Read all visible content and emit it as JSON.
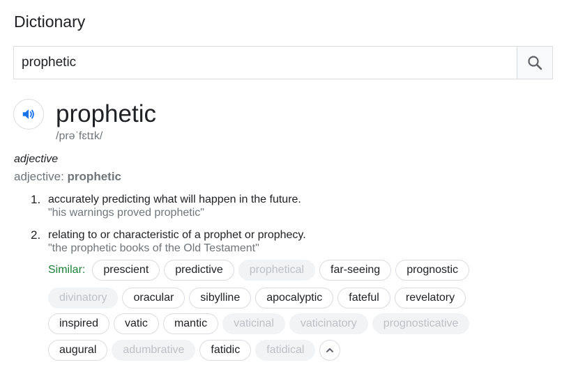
{
  "header": {
    "title": "Dictionary"
  },
  "search": {
    "value": "prophetic",
    "placeholder": ""
  },
  "entry": {
    "word": "prophetic",
    "phonetic": "/prəˈfɛtɪk/",
    "part_of_speech": "adjective",
    "pos_prefix": "adjective: ",
    "pos_word": "prophetic",
    "definitions": [
      {
        "number": "1.",
        "text": "accurately predicting what will happen in the future.",
        "example": "\"his warnings proved prophetic\""
      },
      {
        "number": "2.",
        "text": "relating to or characteristic of a prophet or prophecy.",
        "example": "\"the prophetic books of the Old Testament\""
      }
    ]
  },
  "similar": {
    "label": "Similar:",
    "chips": [
      {
        "label": "prescient",
        "muted": false
      },
      {
        "label": "predictive",
        "muted": false
      },
      {
        "label": "prophetical",
        "muted": true
      },
      {
        "label": "far-seeing",
        "muted": false
      },
      {
        "label": "prognostic",
        "muted": false
      },
      {
        "label": "divinatory",
        "muted": true
      },
      {
        "label": "oracular",
        "muted": false
      },
      {
        "label": "sibylline",
        "muted": false
      },
      {
        "label": "apocalyptic",
        "muted": false
      },
      {
        "label": "fateful",
        "muted": false
      },
      {
        "label": "revelatory",
        "muted": false
      },
      {
        "label": "inspired",
        "muted": false
      },
      {
        "label": "vatic",
        "muted": false
      },
      {
        "label": "mantic",
        "muted": false
      },
      {
        "label": "vaticinal",
        "muted": true
      },
      {
        "label": "vaticinatory",
        "muted": true
      },
      {
        "label": "prognosticative",
        "muted": true
      },
      {
        "label": "augural",
        "muted": false
      },
      {
        "label": "adumbrative",
        "muted": true
      },
      {
        "label": "fatidic",
        "muted": false
      },
      {
        "label": "fatidical",
        "muted": true
      }
    ]
  },
  "icons": {
    "search": "search-icon",
    "speaker": "speaker-icon",
    "collapse": "chevron-up-icon"
  },
  "colors": {
    "accent_blue": "#1a73e8",
    "similar_green": "#188038",
    "muted_text": "#70757a"
  }
}
